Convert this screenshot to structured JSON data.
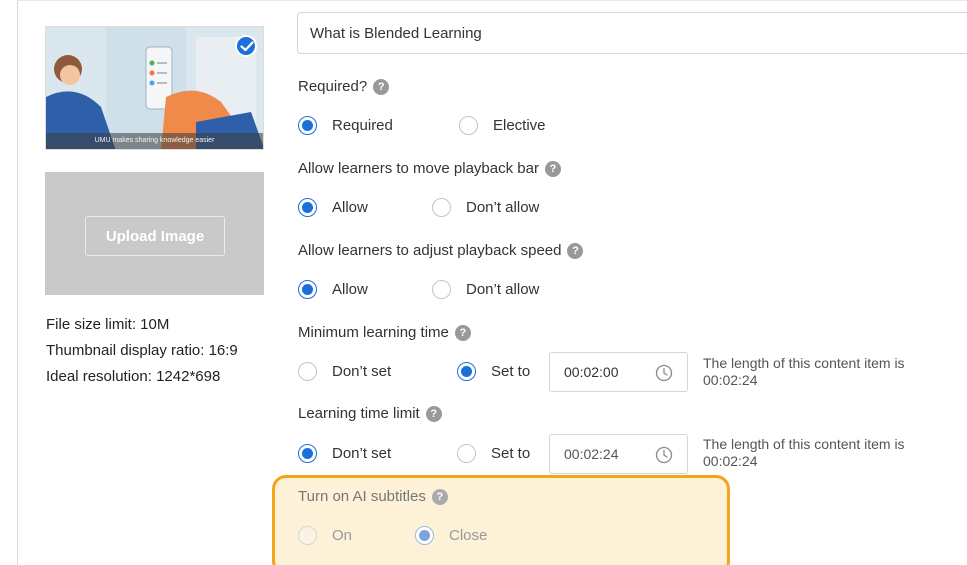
{
  "thumbnail": {
    "caption": "UMU makes sharing knowledge easier",
    "selected": true
  },
  "upload": {
    "button_label": "Upload Image"
  },
  "image_info": {
    "size_limit": "File size limit: 10M",
    "ratio": "Thumbnail display ratio: 16:9",
    "resolution": "Ideal resolution: 1242*698"
  },
  "title_field": {
    "value": "What is Blended Learning"
  },
  "help_icon_glyph": "?",
  "required": {
    "label": "Required?",
    "options": [
      "Required",
      "Elective"
    ],
    "selected": "Required"
  },
  "playback_bar": {
    "label": "Allow learners to move playback bar",
    "options": [
      "Allow",
      "Don’t allow"
    ],
    "selected": "Allow"
  },
  "playback_speed": {
    "label": "Allow learners to adjust playback speed",
    "options": [
      "Allow",
      "Don’t allow"
    ],
    "selected": "Allow"
  },
  "min_learning_time": {
    "label": "Minimum learning time",
    "options": [
      "Don’t set",
      "Set to"
    ],
    "selected": "Set to",
    "time_value": "00:02:00",
    "note_line1": "The length of this content item is",
    "note_line2": "00:02:24"
  },
  "learning_time_limit": {
    "label": "Learning time limit",
    "options": [
      "Don’t set",
      "Set to"
    ],
    "selected": "Don’t set",
    "time_value": "00:02:24",
    "note_line1": "The length of this content item is",
    "note_line2": "00:02:24"
  },
  "ai_subtitles": {
    "label": "Turn on AI subtitles",
    "options": [
      "On",
      "Close"
    ],
    "selected": "Close",
    "disabled": true
  },
  "colors": {
    "accent": "#1a6fdc",
    "highlight_border": "#f4a31b",
    "highlight_fill": "#fdf1d8"
  }
}
